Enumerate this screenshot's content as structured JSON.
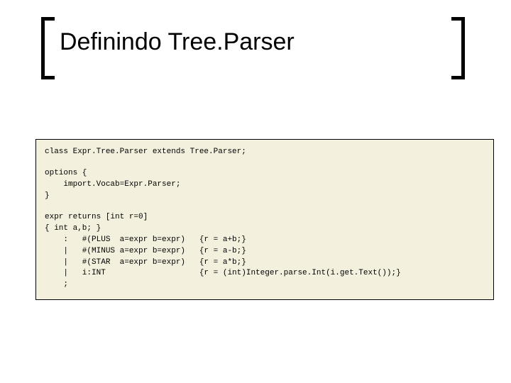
{
  "title": "Definindo Tree.Parser",
  "code": {
    "l1": "class Expr.Tree.Parser extends Tree.Parser;",
    "l2": "options {",
    "l3": "    import.Vocab=Expr.Parser;",
    "l4": "}",
    "l5": "expr returns [int r=0]",
    "l6": "{ int a,b; }",
    "l7": "    :   #(PLUS  a=expr b=expr)   {r = a+b;}",
    "l8": "    |   #(MINUS a=expr b=expr)   {r = a-b;}",
    "l9": "    |   #(STAR  a=expr b=expr)   {r = a*b;}",
    "l10": "    |   i:INT                    {r = (int)Integer.parse.Int(i.get.Text());}",
    "l11": "    ;"
  }
}
